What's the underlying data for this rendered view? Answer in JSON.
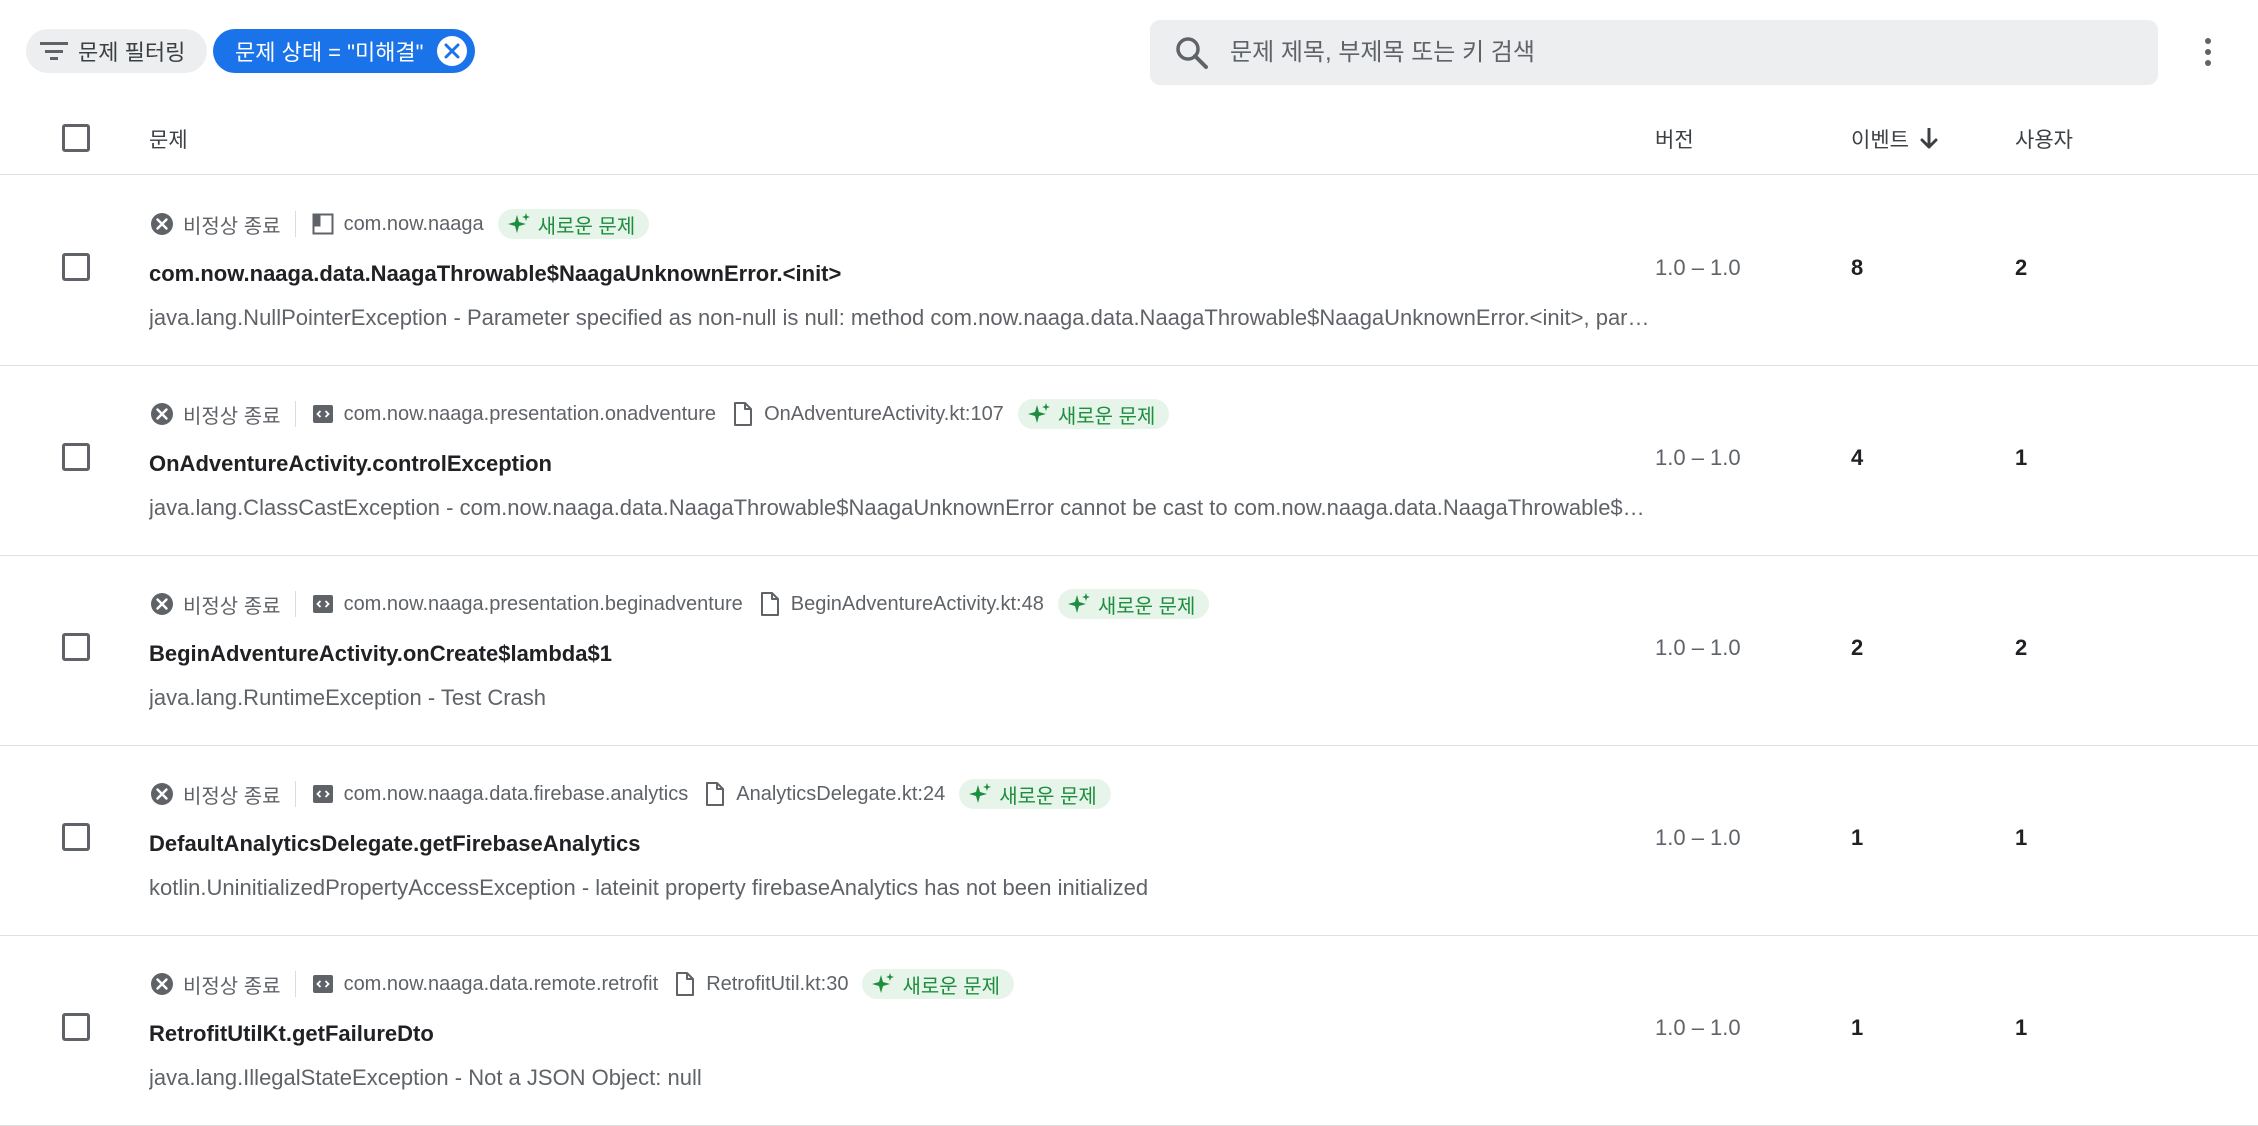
{
  "toolbar": {
    "filter_label": "문제 필터링",
    "status_chip_label": "문제 상태 = \"미해결\"",
    "search_placeholder": "문제 제목, 부제목 또는 키 검색"
  },
  "columns": {
    "issue": "문제",
    "version": "버전",
    "events": "이벤트",
    "users": "사용자"
  },
  "rows": [
    {
      "type": "비정상 종료",
      "package": "com.now.naaga",
      "file": "",
      "badge": "새로운 문제",
      "title": "com.now.naaga.data.NaagaThrowable$NaagaUnknownError.<init>",
      "desc": "java.lang.NullPointerException - Parameter specified as non-null is null: method com.now.naaga.data.NaagaThrowable$NaagaUnknownError.<init>, parameter message",
      "version": "1.0 – 1.0",
      "events": "8",
      "users": "2"
    },
    {
      "type": "비정상 종료",
      "package": "com.now.naaga.presentation.onadventure",
      "file": "OnAdventureActivity.kt:107",
      "badge": "새로운 문제",
      "title": "OnAdventureActivity.controlException",
      "desc": "java.lang.ClassCastException - com.now.naaga.data.NaagaThrowable$NaagaUnknownError cannot be cast to com.now.naaga.data.NaagaThrowable$BackEndError",
      "version": "1.0 – 1.0",
      "events": "4",
      "users": "1"
    },
    {
      "type": "비정상 종료",
      "package": "com.now.naaga.presentation.beginadventure",
      "file": "BeginAdventureActivity.kt:48",
      "badge": "새로운 문제",
      "title": "BeginAdventureActivity.onCreate$lambda$1",
      "desc": "java.lang.RuntimeException - Test Crash",
      "version": "1.0 – 1.0",
      "events": "2",
      "users": "2"
    },
    {
      "type": "비정상 종료",
      "package": "com.now.naaga.data.firebase.analytics",
      "file": "AnalyticsDelegate.kt:24",
      "badge": "새로운 문제",
      "title": "DefaultAnalyticsDelegate.getFirebaseAnalytics",
      "desc": "kotlin.UninitializedPropertyAccessException - lateinit property firebaseAnalytics has not been initialized",
      "version": "1.0 – 1.0",
      "events": "1",
      "users": "1"
    },
    {
      "type": "비정상 종료",
      "package": "com.now.naaga.data.remote.retrofit",
      "file": "RetrofitUtil.kt:30",
      "badge": "새로운 문제",
      "title": "RetrofitUtilKt.getFailureDto",
      "desc": "java.lang.IllegalStateException - Not a JSON Object: null",
      "version": "1.0 – 1.0",
      "events": "1",
      "users": "1"
    }
  ],
  "colors": {
    "accent": "#1a73e8",
    "badge_bg": "#e6f4ea",
    "badge_fg": "#1e8e3e"
  }
}
